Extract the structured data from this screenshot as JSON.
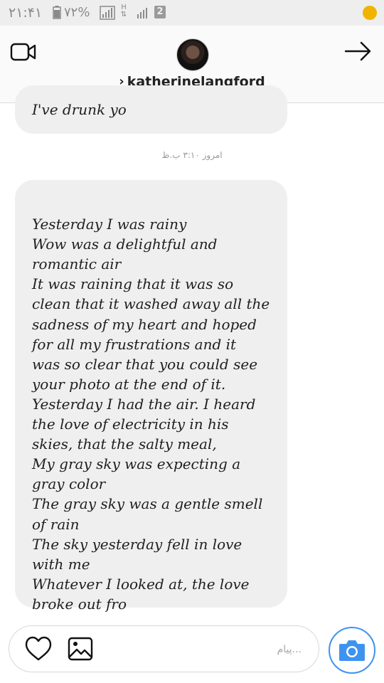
{
  "status_bar": {
    "time": "۲۱:۴۱",
    "battery": "۷۲%",
    "network_type": "H",
    "sim_slot": "2"
  },
  "header": {
    "username": "katherinelangford"
  },
  "messages": {
    "top_partial": "I've drunk yo",
    "timestamp": "امروز ۳:۱۰ ب.ظ",
    "main": "Yesterday I was rainy\nWow was a delightful and\nromantic air\nIt was raining that it was so\nclean that it washed away all the\nsadness of my heart and hoped\nfor all my frustrations and it\nwas so clear that you could see\nyour photo at the end of it.\nYesterday I had the air. I heard\nthe love of electricity in his\nskies, that the salty meal,\nMy gray sky was expecting a\ngray color\nThe gray sky was a gentle smell\nof rain\nThe sky yesterday fell in love\nwith me\nWhatever I looked at, the love\nbroke out fro"
  },
  "composer": {
    "placeholder": "پیام...",
    "value": ""
  },
  "icons": {
    "video": "video-camera-icon",
    "forward": "arrow-right-icon",
    "heart": "heart-icon",
    "gallery": "image-icon",
    "camera": "camera-icon"
  },
  "colors": {
    "accent": "#3d93ef",
    "bubble": "#efefef",
    "header_bg": "#fafafa",
    "status_bar_bg": "#eeeeee"
  }
}
